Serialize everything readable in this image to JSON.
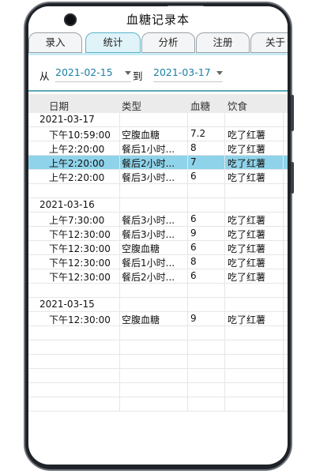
{
  "app": {
    "title": "血糖记录本"
  },
  "tabs": [
    {
      "label": "录入",
      "active": false
    },
    {
      "label": "统计",
      "active": true
    },
    {
      "label": "分析",
      "active": false
    },
    {
      "label": "注册",
      "active": false
    },
    {
      "label": "关于",
      "active": false
    }
  ],
  "filter": {
    "from_label": "从",
    "from_date": "2021-02-15",
    "to_label": "到",
    "to_date": "2021-03-17"
  },
  "table": {
    "headers": [
      "日期",
      "类型",
      "血糖",
      "饮食"
    ],
    "rows": [
      {
        "kind": "group",
        "date": "2021-03-17"
      },
      {
        "kind": "record",
        "time": "下午10:59:00",
        "type": "空腹血糖",
        "sugar": "7.2",
        "food": "吃了红薯"
      },
      {
        "kind": "record",
        "time": "上午2:20:00",
        "type": "餐后1小时...",
        "sugar": "8",
        "food": "吃了红薯"
      },
      {
        "kind": "record",
        "time": "上午2:20:00",
        "type": "餐后2小时...",
        "sugar": "7",
        "food": "吃了红薯",
        "selected": true
      },
      {
        "kind": "record",
        "time": "上午2:20:00",
        "type": "餐后3小时...",
        "sugar": "6",
        "food": "吃了红薯"
      },
      {
        "kind": "blank"
      },
      {
        "kind": "group",
        "date": "2021-03-16"
      },
      {
        "kind": "record",
        "time": "上午7:30:00",
        "type": "餐后3小时...",
        "sugar": "6",
        "food": "吃了红薯"
      },
      {
        "kind": "record",
        "time": "下午12:30:00",
        "type": "餐后3小时...",
        "sugar": "9",
        "food": "吃了红薯"
      },
      {
        "kind": "record",
        "time": "下午12:30:00",
        "type": "空腹血糖",
        "sugar": "6",
        "food": "吃了红薯"
      },
      {
        "kind": "record",
        "time": "下午12:30:00",
        "type": "餐后1小时...",
        "sugar": "8",
        "food": "吃了红薯"
      },
      {
        "kind": "record",
        "time": "下午12:30:00",
        "type": "餐后2小时...",
        "sugar": "6",
        "food": "吃了红薯"
      },
      {
        "kind": "blank"
      },
      {
        "kind": "group",
        "date": "2021-03-15"
      },
      {
        "kind": "record",
        "time": "下午12:30:00",
        "type": "空腹血糖",
        "sugar": "9",
        "food": "吃了红薯"
      },
      {
        "kind": "blank"
      },
      {
        "kind": "blank"
      },
      {
        "kind": "blank"
      },
      {
        "kind": "blank"
      },
      {
        "kind": "blank"
      },
      {
        "kind": "blank"
      }
    ]
  },
  "colors": {
    "selected_row": "#8fd3ea",
    "date_value": "#1a7fa6",
    "active_tab": "#dff3f8"
  }
}
